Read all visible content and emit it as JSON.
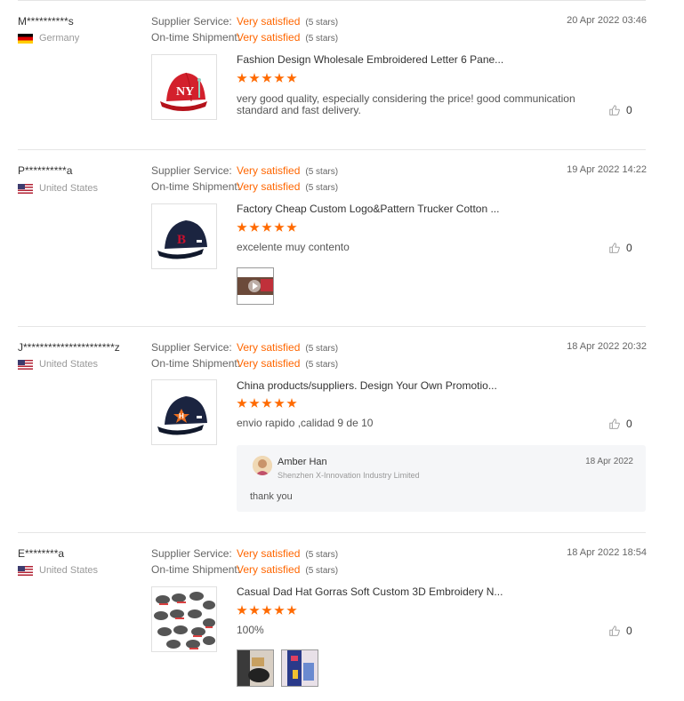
{
  "labels": {
    "supplier_service": "Supplier Service:",
    "ontime_shipment": "On-time Shipment:"
  },
  "colors": {
    "accent": "#ff6a00",
    "divider": "#e5e5e5",
    "reply_bg": "#f5f6f8"
  },
  "reviews": [
    {
      "buyer": "M**********s",
      "country": "Germany",
      "flag": "flag-de",
      "supplier_service": {
        "rating": "Very satisfied",
        "stars": "(5 stars)"
      },
      "ontime_shipment": {
        "rating": "Very satisfied",
        "stars": "(5 stars)"
      },
      "date": "20 Apr 2022 03:46",
      "product_title": "Fashion Design Wholesale Embroidered Letter 6 Pane...",
      "product_icon": "red-ny-cap",
      "product_rating": 5,
      "text": "very good quality, especially considering the price! good communication standard and fast delivery.",
      "likes": "0"
    },
    {
      "buyer": "P**********a",
      "country": "United States",
      "flag": "flag-us",
      "supplier_service": {
        "rating": "Very satisfied",
        "stars": "(5 stars)"
      },
      "ontime_shipment": {
        "rating": "Very satisfied",
        "stars": "(5 stars)"
      },
      "date": "19 Apr 2022 14:22",
      "product_title": "Factory Cheap Custom Logo&Pattern Trucker Cotton ...",
      "product_icon": "navy-b-cap",
      "product_rating": 5,
      "text": "excelente  muy contento",
      "likes": "0",
      "attachments": [
        "video-thumbnail"
      ]
    },
    {
      "buyer": "J**********************z",
      "country": "United States",
      "flag": "flag-us",
      "supplier_service": {
        "rating": "Very satisfied",
        "stars": "(5 stars)"
      },
      "ontime_shipment": {
        "rating": "Very satisfied",
        "stars": "(5 stars)"
      },
      "date": "18 Apr 2022 20:32",
      "product_title": "China products/suppliers. Design Your Own Promotio...",
      "product_icon": "navy-h-cap",
      "product_rating": 5,
      "text": "envio rapido ,calidad 9 de 10",
      "likes": "0",
      "reply": {
        "name": "Amber Han",
        "company": "Shenzhen X-Innovation Industry Limited",
        "date": "18 Apr 2022",
        "text": "thank you"
      }
    },
    {
      "buyer": "E********a",
      "country": "United States",
      "flag": "flag-us",
      "supplier_service": {
        "rating": "Very satisfied",
        "stars": "(5 stars)"
      },
      "ontime_shipment": {
        "rating": "Very satisfied",
        "stars": "(5 stars)"
      },
      "date": "18 Apr 2022 18:54",
      "product_title": "Casual Dad Hat Gorras Soft Custom 3D Embroidery N...",
      "product_icon": "cap-collection",
      "product_rating": 5,
      "text": "100%",
      "likes": "0",
      "attachments": [
        "photo-1",
        "photo-2"
      ]
    }
  ]
}
